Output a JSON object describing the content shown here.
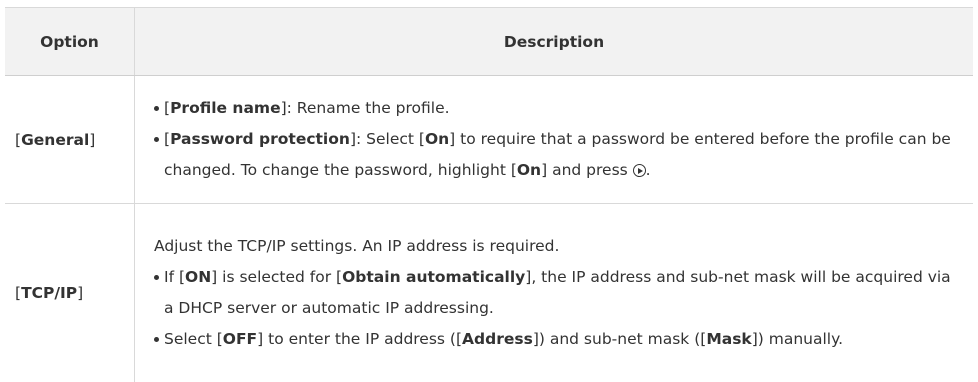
{
  "header": {
    "option": "Option",
    "description": "Description"
  },
  "rows": [
    {
      "option": "General",
      "bullets": [
        {
          "label": "Profile name",
          "text": ": Rename the profile."
        },
        {
          "label": "Password protection",
          "text_a": ": Select [",
          "on1": "On",
          "text_b": "] to require that a password be entered before the profile can be changed. To change the password, highlight [",
          "on2": "On",
          "text_c": "] and press",
          "icon": "multi-selector-right-icon",
          "text_d": "."
        }
      ]
    },
    {
      "option": "TCP/IP",
      "intro": "Adjust the TCP/IP settings. An IP address is required.",
      "bullets": [
        {
          "pre": "If [",
          "on": "ON",
          "mid": "] is selected for [",
          "label": "Obtain automatically",
          "post": "], the IP address and sub-net mask will be acquired via a DHCP server or automatic IP addressing."
        },
        {
          "pre": "Select [",
          "off": "OFF",
          "mid": "] to enter the IP address ([",
          "address": "Address",
          "mid2": "]) and sub-net mask ([",
          "mask": "Mask",
          "post": "]) manually."
        }
      ]
    }
  ]
}
